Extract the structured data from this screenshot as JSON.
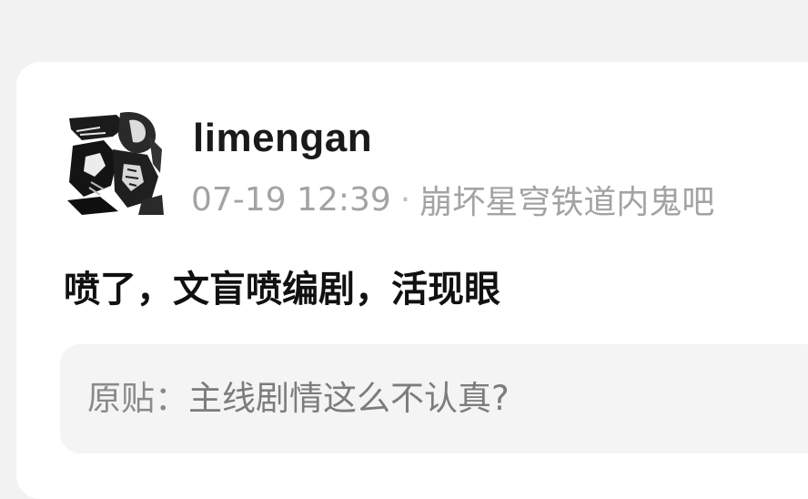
{
  "post": {
    "username": "limengan",
    "timestamp": "07-19 12:39",
    "separator": "·",
    "forum": "崩坏星穹铁道内鬼吧",
    "content": "喷了，文盲喷编剧，活现眼",
    "quote": {
      "label": "原贴：",
      "text": "主线剧情这么不认真?"
    },
    "avatar_icon": "user-avatar-icon"
  }
}
